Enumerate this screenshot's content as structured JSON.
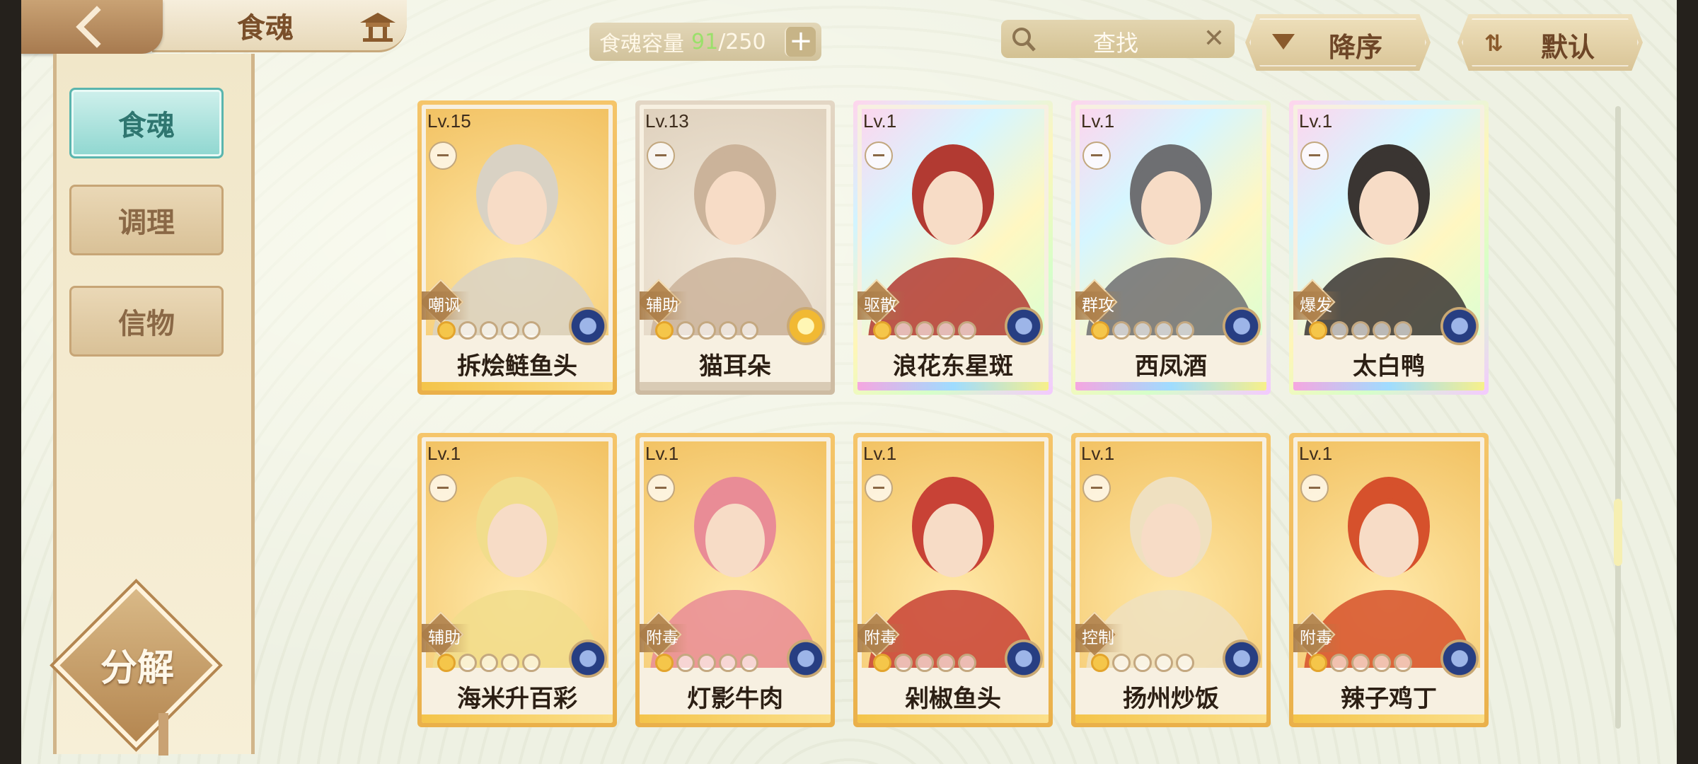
{
  "header": {
    "title": "食魂",
    "back_icon": "chevron-left-icon",
    "home_icon": "pavilion-icon"
  },
  "capacity": {
    "label": "食魂容量",
    "current": "91",
    "separator": "/",
    "max": "250",
    "plus": "+"
  },
  "search": {
    "placeholder": "查找",
    "clear": "✕"
  },
  "sort": {
    "order_label": "降序",
    "default_label": "默认"
  },
  "sidebar": {
    "tabs": [
      {
        "label": "食魂",
        "active": true
      },
      {
        "label": "调理",
        "active": false
      },
      {
        "label": "信物",
        "active": false
      }
    ],
    "decompose_label": "分解"
  },
  "cards": [
    {
      "level": "Lv.15",
      "role": "嘲讽",
      "name": "拆烩鲢鱼头",
      "frame": "gold",
      "stars": 1,
      "element": "blue"
    },
    {
      "level": "Lv.13",
      "role": "辅助",
      "name": "猫耳朵",
      "frame": "plain",
      "stars": 1,
      "element": "gold"
    },
    {
      "level": "Lv.1",
      "role": "驱散",
      "name": "浪花东星斑",
      "frame": "rainbow",
      "stars": 1,
      "element": "blue"
    },
    {
      "level": "Lv.1",
      "role": "群攻",
      "name": "西凤酒",
      "frame": "rainbow",
      "stars": 1,
      "element": "blue"
    },
    {
      "level": "Lv.1",
      "role": "爆发",
      "name": "太白鸭",
      "frame": "rainbow",
      "stars": 1,
      "element": "blue"
    },
    {
      "level": "Lv.1",
      "role": "辅助",
      "name": "海米升百彩",
      "frame": "gold",
      "stars": 1,
      "element": "blue"
    },
    {
      "level": "Lv.1",
      "role": "附毒",
      "name": "灯影牛肉",
      "frame": "gold",
      "stars": 1,
      "element": "blue"
    },
    {
      "level": "Lv.1",
      "role": "附毒",
      "name": "剁椒鱼头",
      "frame": "gold",
      "stars": 1,
      "element": "blue"
    },
    {
      "level": "Lv.1",
      "role": "控制",
      "name": "扬州炒饭",
      "frame": "gold",
      "stars": 1,
      "element": "blue"
    },
    {
      "level": "Lv.1",
      "role": "附毒",
      "name": "辣子鸡丁",
      "frame": "gold",
      "stars": 1,
      "element": "blue"
    }
  ],
  "portrait_colors": [
    "#d9d2c4",
    "#cbb39a",
    "#b23a32",
    "#6e6f72",
    "#3a3532",
    "#f1dd8c",
    "#e98c96",
    "#c84236",
    "#efe0c0",
    "#d6512c"
  ]
}
